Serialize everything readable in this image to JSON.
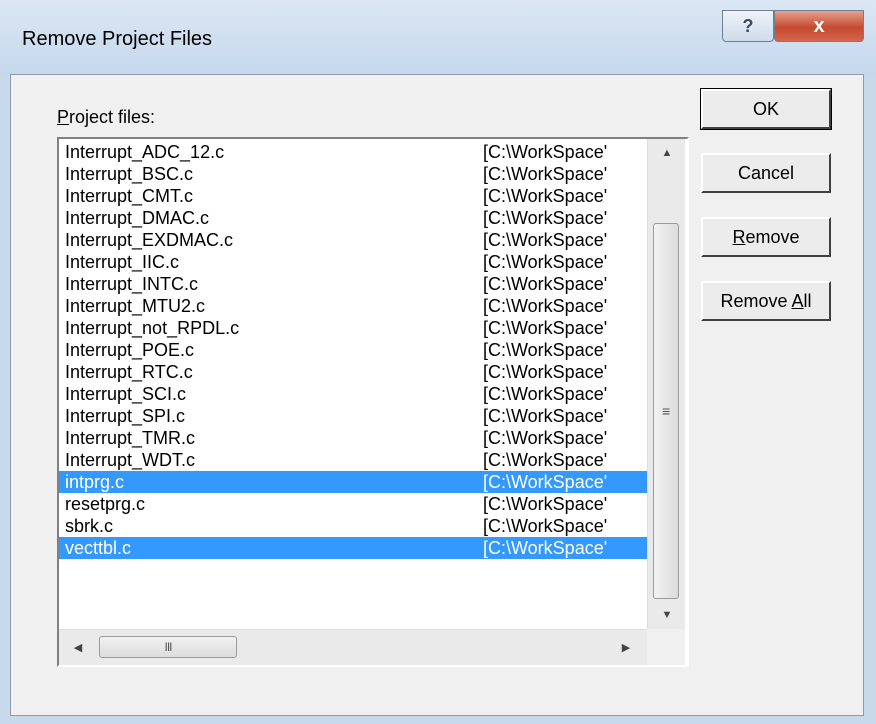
{
  "window": {
    "title": "Remove Project Files"
  },
  "titlebar": {
    "help_glyph": "?",
    "close_glyph": "x"
  },
  "label": {
    "project_files_prefix": "P",
    "project_files_rest": "roject files:"
  },
  "files": [
    {
      "name": "Interrupt_ADC_12.c",
      "path": "[C:\\WorkSpace'",
      "selected": false
    },
    {
      "name": "Interrupt_BSC.c",
      "path": "[C:\\WorkSpace'",
      "selected": false
    },
    {
      "name": "Interrupt_CMT.c",
      "path": "[C:\\WorkSpace'",
      "selected": false
    },
    {
      "name": "Interrupt_DMAC.c",
      "path": "[C:\\WorkSpace'",
      "selected": false
    },
    {
      "name": "Interrupt_EXDMAC.c",
      "path": "[C:\\WorkSpace'",
      "selected": false
    },
    {
      "name": "Interrupt_IIC.c",
      "path": "[C:\\WorkSpace'",
      "selected": false
    },
    {
      "name": "Interrupt_INTC.c",
      "path": "[C:\\WorkSpace'",
      "selected": false
    },
    {
      "name": "Interrupt_MTU2.c",
      "path": "[C:\\WorkSpace'",
      "selected": false
    },
    {
      "name": "Interrupt_not_RPDL.c",
      "path": "[C:\\WorkSpace'",
      "selected": false
    },
    {
      "name": "Interrupt_POE.c",
      "path": "[C:\\WorkSpace'",
      "selected": false
    },
    {
      "name": "Interrupt_RTC.c",
      "path": "[C:\\WorkSpace'",
      "selected": false
    },
    {
      "name": "Interrupt_SCI.c",
      "path": "[C:\\WorkSpace'",
      "selected": false
    },
    {
      "name": "Interrupt_SPI.c",
      "path": "[C:\\WorkSpace'",
      "selected": false
    },
    {
      "name": "Interrupt_TMR.c",
      "path": "[C:\\WorkSpace'",
      "selected": false
    },
    {
      "name": "Interrupt_WDT.c",
      "path": "[C:\\WorkSpace'",
      "selected": false
    },
    {
      "name": "intprg.c",
      "path": "[C:\\WorkSpace'",
      "selected": true
    },
    {
      "name": "resetprg.c",
      "path": "[C:\\WorkSpace'",
      "selected": false
    },
    {
      "name": "sbrk.c",
      "path": "[C:\\WorkSpace'",
      "selected": false
    },
    {
      "name": "vecttbl.c",
      "path": "[C:\\WorkSpace'",
      "selected": true
    }
  ],
  "buttons": {
    "ok": "OK",
    "cancel": "Cancel",
    "remove_prefix": "R",
    "remove_rest": "emove",
    "remove_all_prefix": "Remove ",
    "remove_all_mnemonic": "A",
    "remove_all_rest": "ll"
  },
  "scrollbar": {
    "up_icon": "▲",
    "down_icon": "▼",
    "left_icon": "◀",
    "right_icon": "▶",
    "v_grip": "≡",
    "h_grip": "III"
  },
  "colors": {
    "selection": "#3399ff",
    "close_button": "#c44a30"
  }
}
